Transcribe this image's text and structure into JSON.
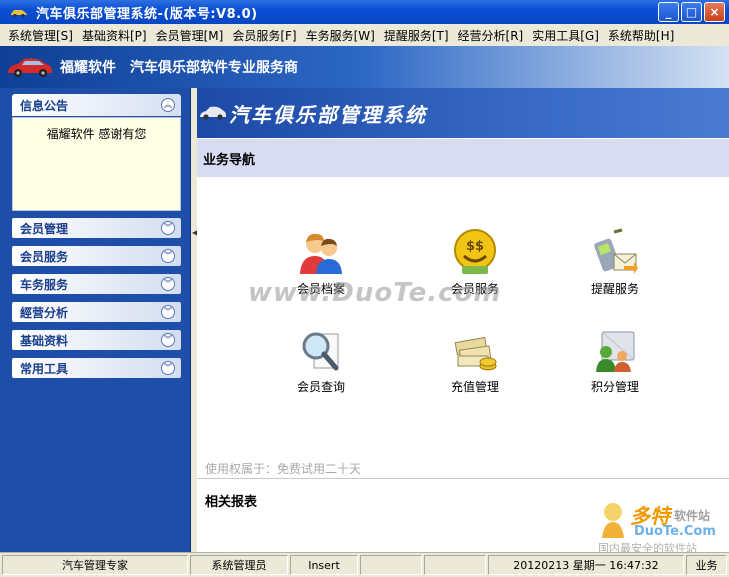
{
  "window": {
    "title": "汽车俱乐部管理系统-(版本号:V8.0)",
    "min": "_",
    "max": "□",
    "close": "×"
  },
  "menu": [
    "系统管理[S]",
    "基础资料[P]",
    "会员管理[M]",
    "会员服务[F]",
    "车务服务[W]",
    "提醒服务[T]",
    "经营分析[R]",
    "实用工具[G]",
    "系统帮助[H]"
  ],
  "brand": {
    "company": "福耀软件",
    "slogan": "汽车俱乐部软件专业服务商"
  },
  "sidebar": {
    "notice_title": "信息公告",
    "notice_text": "福耀软件 感谢有您",
    "sections": [
      "会员管理",
      "会员服务",
      "车务服务",
      "經营分析",
      "基础资料",
      "常用工具"
    ]
  },
  "main": {
    "title": "汽车俱乐部管理系统",
    "nav_label": "业务导航",
    "tiles": [
      {
        "label": "会员档案",
        "icon": "members-icon"
      },
      {
        "label": "会员服务",
        "icon": "money-service-icon"
      },
      {
        "label": "提醒服务",
        "icon": "reminder-phone-icon"
      },
      {
        "label": "会员查询",
        "icon": "search-document-icon"
      },
      {
        "label": "充值管理",
        "icon": "cash-coins-icon"
      },
      {
        "label": "积分管理",
        "icon": "points-people-icon"
      }
    ],
    "license": "使用权属于：免费试用二十天",
    "report_label": "相关报表"
  },
  "watermark": {
    "center": "www.DuoTe.com",
    "corner_cn": "多特",
    "corner_sub": "软件站",
    "corner_url": "DuoTe.Com",
    "corner_slogan": "国内最安全的软件站"
  },
  "status": {
    "app": "汽车管理专家",
    "user": "系统管理员",
    "mode": "Insert",
    "datetime": "20120213 星期一 16:47:32",
    "extra": "业务"
  }
}
